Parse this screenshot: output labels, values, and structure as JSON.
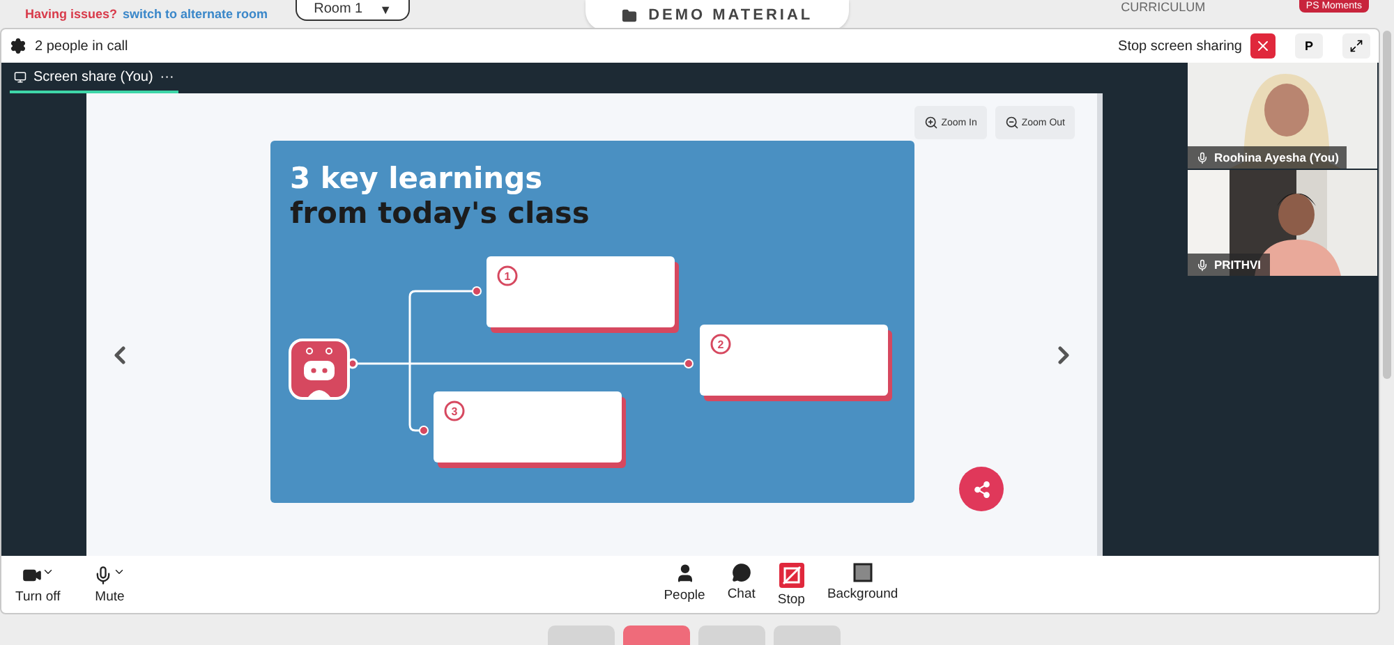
{
  "top_bar": {
    "issue_text": "Having issues?",
    "switch_link": "switch to alternate room",
    "room_select": {
      "value": "Room 1",
      "caret": "▼"
    },
    "demo_button": "DEMO MATERIAL",
    "curriculum_tab": "CURRICULUM",
    "moments_badge": "PS Moments"
  },
  "call_header": {
    "people_count": "2 people in call",
    "stop_sharing_label": "Stop screen sharing",
    "avatar_initial": "P"
  },
  "tabs": [
    {
      "label": "Screen share (You)",
      "selected": true,
      "menu": "···"
    }
  ],
  "viewer": {
    "zoom_buttons": [
      "Zoom In",
      "Zoom Out"
    ],
    "slide": {
      "title_line_1": "3 key learnings",
      "title_line_2": "from today's class",
      "steps": [
        "1",
        "2",
        "3"
      ]
    }
  },
  "participants": [
    {
      "name": "Roohina Ayesha (You)",
      "kind": "picture"
    },
    {
      "name": "PRITHVI",
      "kind": "picture"
    }
  ],
  "toolbar": {
    "left": [
      {
        "label": "Turn off",
        "kind": "camera"
      },
      {
        "label": "Mute",
        "kind": "mic"
      }
    ],
    "center": [
      {
        "label": "People",
        "kind": "people"
      },
      {
        "label": "Chat",
        "kind": "chat"
      },
      {
        "label": "Stop",
        "kind": "stop"
      },
      {
        "label": "Background",
        "kind": "background"
      }
    ]
  },
  "dock": [
    {
      "active": false
    },
    {
      "active": true
    },
    {
      "active": false
    },
    {
      "active": false
    }
  ]
}
